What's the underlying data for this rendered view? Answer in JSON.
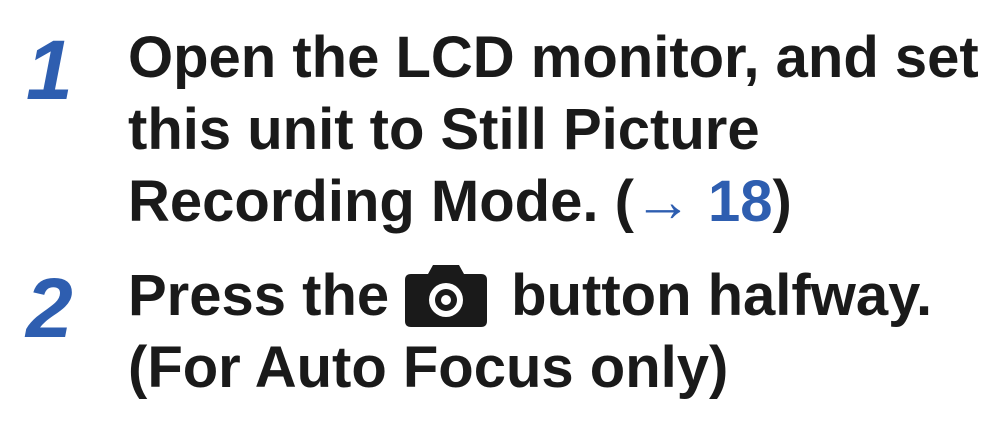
{
  "steps": [
    {
      "number": "1",
      "lines": [
        "Open the LCD monitor, and set",
        "this unit to Still Picture"
      ],
      "last_line_prefix": "Recording Mode. (",
      "ref_arrow": "→",
      "ref_page": "18",
      "last_line_suffix": ")"
    },
    {
      "number": "2",
      "line1_before_icon": "Press the",
      "icon": "camera-icon",
      "line1_after_icon": "button halfway.",
      "line2": "(For Auto Focus only)"
    }
  ],
  "colors": {
    "accent": "#2e5eb0",
    "text": "#1a1a1a",
    "background": "#ffffff"
  }
}
